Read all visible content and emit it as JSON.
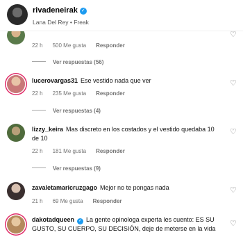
{
  "header": {
    "username": "rivadeneirak",
    "verified_mark": "✓",
    "subtitle": "Lana Del Rey • Freak"
  },
  "comments": [
    {
      "username": "",
      "text": "",
      "time": "22 h",
      "likes": "500 Me gusta",
      "reply_label": "Responder",
      "replies": "Ver respuestas (56)"
    },
    {
      "username": "lucerovargas31",
      "text": "Ese vestido nada que ver",
      "time": "22 h",
      "likes": "235 Me gusta",
      "reply_label": "Responder",
      "replies": "Ver respuestas (4)"
    },
    {
      "username": "lizzy_keira",
      "text": "Mas discreto en los costados y el vestido quedaba 10 de 10",
      "time": "22 h",
      "likes": "181 Me gusta",
      "reply_label": "Responder",
      "replies": "Ver respuestas (9)"
    },
    {
      "username": "zavaletamaricruzgago",
      "text": "Mejor no te pongas nada",
      "time": "21 h",
      "likes": "69 Me gusta",
      "reply_label": "Responder",
      "replies": ""
    },
    {
      "username": "dakotadqueen",
      "verified_mark": "✓",
      "text": "La gente opinologa experta les cuento: ES SU GUSTO, SU CUERPO, SU DECISIÓN, deje de meterse en la vida",
      "time": "",
      "likes": "",
      "reply_label": "",
      "replies": ""
    }
  ],
  "icons": {
    "heart": "heart-icon",
    "verified": "verified-badge-icon"
  },
  "colors": {
    "text_primary": "#000000",
    "text_secondary": "#737373",
    "verified_blue": "#1d9bf0",
    "story_ring": "#e1306c"
  }
}
